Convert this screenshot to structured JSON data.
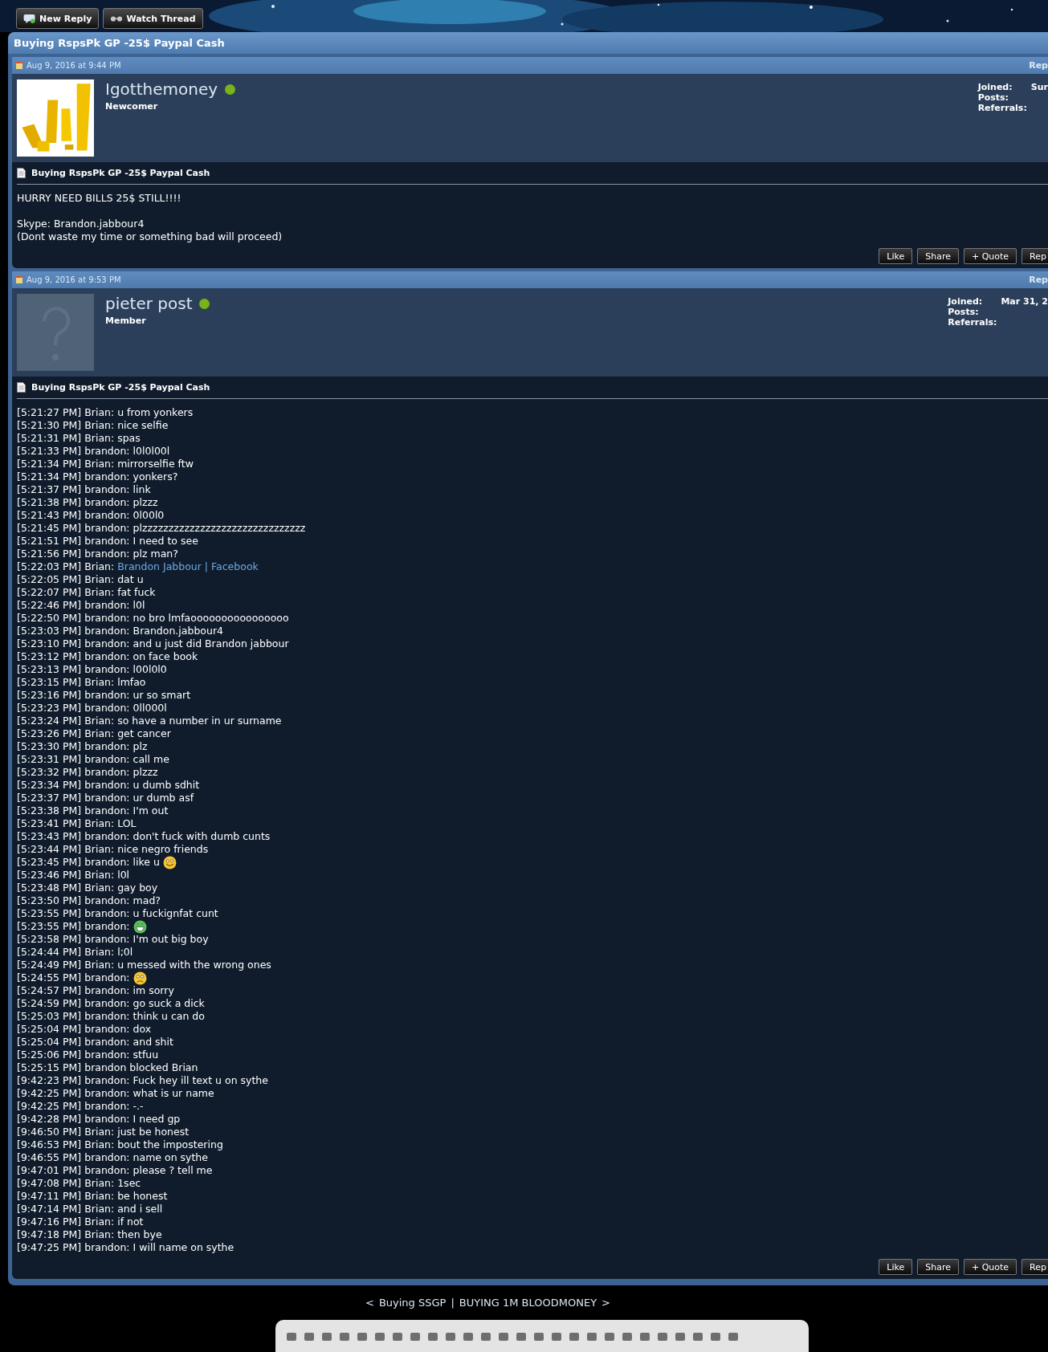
{
  "toolbar": [
    {
      "label": "New Reply"
    },
    {
      "label": "Watch Thread"
    }
  ],
  "thread": {
    "title": "Buying RspsPk GP -25$ Paypal Cash",
    "posts": [
      {
        "date": "Aug 9, 2016 at 9:44 PM",
        "header_link": "Rep",
        "username": "Igotthemoney",
        "online": true,
        "rank": "Newcomer",
        "avatar": {
          "kind": "picture"
        },
        "stats": [
          {
            "label": "Joined:",
            "value": "Sur"
          },
          {
            "label": "Posts:"
          },
          {
            "label": "Referrals:"
          }
        ],
        "message_title": "Buying RspsPk GP -25$ Paypal Cash",
        "lines": [
          {
            "text": "HURRY NEED BILLS 25$ STILL!!!!"
          },
          {
            "kind": "blank"
          },
          {
            "text": "Skype: Brandon.jabbour4"
          },
          {
            "text": "(Dont waste my time or something bad will proceed)"
          }
        ],
        "actions": [
          "Like",
          "Share",
          "+ Quote",
          "Rep"
        ]
      },
      {
        "date": "Aug 9, 2016 at 9:53 PM",
        "header_link": "Rep",
        "username": "pieter post",
        "online": true,
        "rank": "Member",
        "avatar": {
          "kind": "placeholder"
        },
        "stats": [
          {
            "label": "Joined:",
            "value": "Mar 31, 2"
          },
          {
            "label": "Posts:"
          },
          {
            "label": "Referrals:"
          }
        ],
        "message_title": "Buying RspsPk GP -25$ Paypal Cash",
        "lines": [
          {
            "text": "[5:21:27 PM] Brian: u from yonkers"
          },
          {
            "text": "[5:21:30 PM] Brian: nice selfie"
          },
          {
            "text": "[5:21:31 PM] Brian: spas"
          },
          {
            "text": "[5:21:33 PM] brandon: l0l0l00l"
          },
          {
            "text": "[5:21:34 PM] Brian: mirrorselfie ftw"
          },
          {
            "text": "[5:21:34 PM] brandon: yonkers?"
          },
          {
            "text": "[5:21:37 PM] brandon: link"
          },
          {
            "text": "[5:21:38 PM] brandon: plzzz"
          },
          {
            "text": "[5:21:43 PM] brandon: 0l00l0"
          },
          {
            "text": "[5:21:45 PM] brandon: plzzzzzzzzzzzzzzzzzzzzzzzzzzzzzzz"
          },
          {
            "text": "[5:21:51 PM] brandon: I need to see"
          },
          {
            "text": "[5:21:56 PM] brandon: plz man?"
          },
          {
            "text": "[5:22:03 PM] Brian:",
            "link": "Brandon Jabbour | Facebook"
          },
          {
            "text": "[5:22:05 PM] Brian: dat u"
          },
          {
            "text": "[5:22:07 PM] Brian: fat fuck"
          },
          {
            "text": "[5:22:46 PM] brandon: l0l"
          },
          {
            "text": "[5:22:50 PM] brandon: no bro lmfaoooooooooooooooo"
          },
          {
            "text": "[5:23:03 PM] brandon: Brandon.jabbour4"
          },
          {
            "text": "[5:23:10 PM] brandon: and u just did Brandon jabbour"
          },
          {
            "text": "[5:23:12 PM] brandon: on face book"
          },
          {
            "text": "[5:23:13 PM] brandon: l00l0l0"
          },
          {
            "text": "[5:23:15 PM] Brian: lmfao"
          },
          {
            "text": "[5:23:16 PM] brandon: ur so smart"
          },
          {
            "text": "[5:23:23 PM] brandon: 0ll000l"
          },
          {
            "text": "[5:23:24 PM] Brian: so have a number in ur surname"
          },
          {
            "text": "[5:23:26 PM] Brian: get cancer"
          },
          {
            "text": "[5:23:30 PM] brandon: plz"
          },
          {
            "text": "[5:23:31 PM] brandon: call me"
          },
          {
            "text": "[5:23:32 PM] brandon: plzzz"
          },
          {
            "text": "[5:23:34 PM] brandon: u dumb sdhit"
          },
          {
            "text": "[5:23:37 PM] brandon: ur dumb asf"
          },
          {
            "text": "[5:23:38 PM] brandon: I'm out"
          },
          {
            "text": "[5:23:41 PM] Brian: LOL"
          },
          {
            "text": "[5:23:43 PM] brandon: don't fuck with dumb cunts"
          },
          {
            "text": "[5:23:44 PM] Brian: nice negro friends"
          },
          {
            "text": "[5:23:45 PM] brandon: like u",
            "kind": "smile"
          },
          {
            "text": "[5:23:46 PM] Brian: l0l"
          },
          {
            "text": "[5:23:48 PM] Brian: gay boy"
          },
          {
            "text": "[5:23:50 PM] brandon: mad?"
          },
          {
            "text": "[5:23:55 PM] brandon: u fuckignfat cunt"
          },
          {
            "text": "[5:23:55 PM] brandon:",
            "kind": "grin"
          },
          {
            "text": "[5:23:58 PM] brandon: I'm out big boy"
          },
          {
            "text": "[5:24:44 PM] Brian: l;0l"
          },
          {
            "text": "[5:24:49 PM] Brian: u messed with the wrong ones"
          },
          {
            "text": "[5:24:55 PM] brandon:",
            "kind": "frown"
          },
          {
            "text": "[5:24:57 PM] brandon: im sorry"
          },
          {
            "text": "[5:24:59 PM] brandon: go suck a dick"
          },
          {
            "text": "[5:25:03 PM] brandon: think u can do"
          },
          {
            "text": "[5:25:04 PM] brandon: dox"
          },
          {
            "text": "[5:25:04 PM] brandon: and shit"
          },
          {
            "text": "[5:25:06 PM] brandon: stfuu"
          },
          {
            "text": "[5:25:15 PM] brandon blocked Brian"
          },
          {
            "text": "[9:42:23 PM] brandon: Fuck hey ill text u on sythe"
          },
          {
            "text": "[9:42:25 PM] brandon: what is ur name"
          },
          {
            "text": "[9:42:25 PM] brandon: -.-"
          },
          {
            "text": "[9:42:28 PM] brandon: I need gp"
          },
          {
            "text": "[9:46:50 PM] Brian: just be honest"
          },
          {
            "text": "[9:46:53 PM] Brian: bout the impostering"
          },
          {
            "text": "[9:46:55 PM] brandon: name on sythe"
          },
          {
            "text": "[9:47:01 PM] brandon: please ? tell me"
          },
          {
            "text": "[9:47:08 PM] Brian: 1sec"
          },
          {
            "text": "[9:47:11 PM] Brian: be honest"
          },
          {
            "text": "[9:47:14 PM] Brian: and i sell"
          },
          {
            "text": "[9:47:16 PM] Brian: if not"
          },
          {
            "text": "[9:47:18 PM] Brian: then bye"
          },
          {
            "text": "[9:47:25 PM] brandon: I will name on sythe"
          }
        ],
        "actions": [
          "Like",
          "Share",
          "+ Quote",
          "Rep"
        ]
      }
    ]
  },
  "thread_nav": {
    "previous": "Buying SSGP",
    "separator": "|",
    "next": "BUYING 1M BLOODMONEY",
    "prev_mark": "<",
    "next_mark": ">"
  }
}
